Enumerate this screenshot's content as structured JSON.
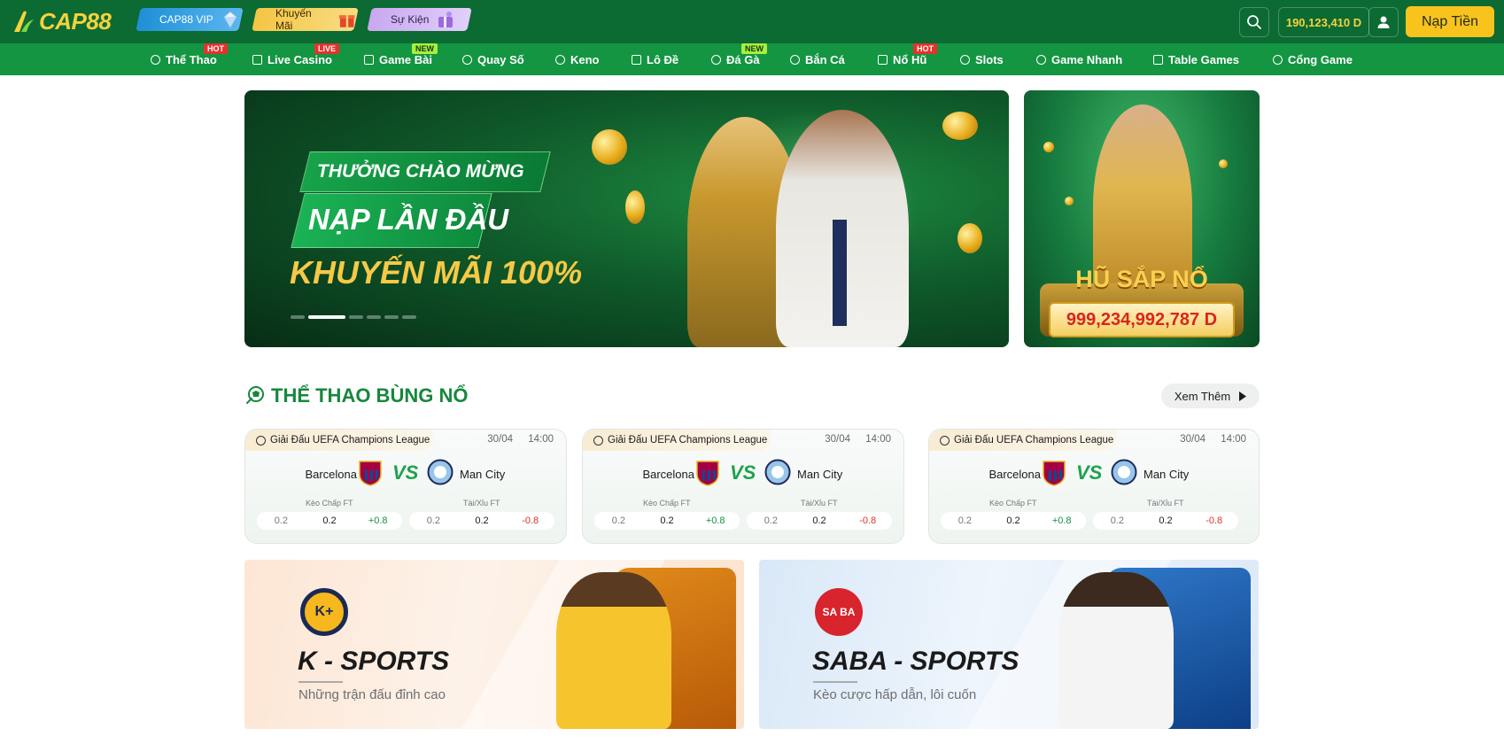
{
  "header": {
    "logo_text": "CAP88",
    "promos": [
      {
        "label": "CAP88 VIP"
      },
      {
        "label": "Khuyến Mãi"
      },
      {
        "label": "Sự Kiện"
      }
    ],
    "balance": "190,123,410 D",
    "deposit_label": "Nạp Tiền"
  },
  "nav": {
    "items": [
      {
        "label": "Thể Thao",
        "badge": "HOT"
      },
      {
        "label": "Live Casino",
        "badge": "LIVE"
      },
      {
        "label": "Game Bài",
        "badge": "NEW"
      },
      {
        "label": "Quay Số"
      },
      {
        "label": "Keno"
      },
      {
        "label": "Lô Đề"
      },
      {
        "label": "Đá Gà",
        "badge": "NEW"
      },
      {
        "label": "Bắn Cá"
      },
      {
        "label": "Nổ Hũ",
        "badge": "HOT"
      },
      {
        "label": "Slots"
      },
      {
        "label": "Game Nhanh"
      },
      {
        "label": "Table Games"
      },
      {
        "label": "Cổng Game"
      }
    ]
  },
  "hero": {
    "line1": "THƯỞNG CHÀO MỪNG",
    "line2": "NẠP LẦN ĐẦU",
    "line3": "KHUYẾN MÃI 100%",
    "slides_total": 6,
    "active_slide": 2
  },
  "jackpot": {
    "title": "HŨ SẮP NỔ",
    "amount": "999,234,992,787 D"
  },
  "sports": {
    "title": "THỂ THAO BÙNG NỔ",
    "see_more": "Xem Thêm",
    "matches": [
      {
        "league": "Giải Đấu UEFA Champions League",
        "date": "30/04",
        "time": "14:00",
        "home": "Barcelona",
        "away": "Man City",
        "vs": "VS",
        "handicap_label": "Kèo Chấp FT",
        "ou_label": "Tài/Xỉu FT",
        "handicap": [
          "0.2",
          "0.2",
          "+0.8"
        ],
        "ou": [
          "0.2",
          "0.2",
          "-0.8"
        ]
      },
      {
        "league": "Giải Đấu UEFA Champions League",
        "date": "30/04",
        "time": "14:00",
        "home": "Barcelona",
        "away": "Man City",
        "vs": "VS",
        "handicap_label": "Kèo Chấp FT",
        "ou_label": "Tài/Xỉu FT",
        "handicap": [
          "0.2",
          "0.2",
          "+0.8"
        ],
        "ou": [
          "0.2",
          "0.2",
          "-0.8"
        ]
      },
      {
        "league": "Giải Đấu UEFA Champions League",
        "date": "30/04",
        "time": "14:00",
        "home": "Barcelona",
        "away": "Man City",
        "vs": "VS",
        "handicap_label": "Kèo Chấp FT",
        "ou_label": "Tài/Xỉu FT",
        "handicap": [
          "0.2",
          "0.2",
          "+0.8"
        ],
        "ou": [
          "0.2",
          "0.2",
          "-0.8"
        ]
      }
    ]
  },
  "providers": [
    {
      "title": "K - SPORTS",
      "subtitle": "Những trận đấu đỉnh cao",
      "logo_text": "K+"
    },
    {
      "title": "SABA - SPORTS",
      "subtitle": "Kèo cược hấp dẫn, lôi cuốn",
      "logo_text": "SA BA"
    }
  ],
  "colors": {
    "header_bg": "#0c6a33",
    "nav_bg": "#149542",
    "accent_gold": "#f8c31d",
    "brand_green": "#16883c",
    "odds_positive": "#18913f",
    "odds_negative": "#d8342c"
  }
}
